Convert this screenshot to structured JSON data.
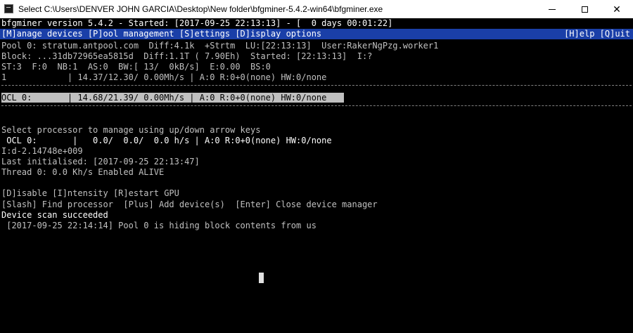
{
  "window": {
    "title": "Select C:\\Users\\DENVER JOHN GARCIA\\Desktop\\New folder\\bfgminer-5.4.2-win64\\bfgminer.exe",
    "min_glyph": "minimize-icon",
    "max_glyph": "maximize-icon",
    "close_glyph": "✕"
  },
  "console": {
    "header": "bfgminer version 5.4.2 - Started: [2017-09-25 22:13:13] - [  0 days 00:01:22]",
    "menu_left": "[M]anage devices [P]ool management [S]ettings [D]isplay options",
    "menu_right": "[H]elp [Q]uit",
    "pool_line": "Pool 0: stratum.antpool.com  Diff:4.1k  +Strtm  LU:[22:13:13]  User:RakerNgPzg.worker1",
    "block_line": "Block: ...31db72965ea5815d  Diff:1.1T ( 7.90Eh)  Started: [22:13:13]  I:?",
    "stats_line": "ST:3  F:0  NB:1  AS:0  BW:[ 13/  0kB/s]  E:0.00  BS:0",
    "summary_line": "1            | 14.37/12.30/ 0.00Mh/s | A:0 R:0+0(none) HW:0/none",
    "device_row": "OCL 0:       | 14.68/21.39/ 0.00Mh/s | A:0 R:0+0(none) HW:0/none",
    "select_prompt": "Select processor to manage using up/down arrow keys",
    "proc_line": " OCL 0:       |   0.0/  0.0/  0.0 h/s | A:0 R:0+0(none) HW:0/none",
    "intensity_line": "I:d-2.14748e+009",
    "last_init_line": "Last initialised: [2017-09-25 22:13:47]",
    "thread_line": "Thread 0: 0.0 Kh/s Enabled ALIVE",
    "gpu_options": "[D]isable [I]ntensity [R]estart GPU",
    "manager_options": "[Slash] Find processor  [Plus] Add device(s)  [Enter] Close device manager",
    "scan_status": "Device scan succeeded",
    "log_line": " [2017-09-25 22:14:14] Pool 0 is hiding block contents from us"
  },
  "colors": {
    "menu_bar": "#1a3fa8",
    "terminal_bg": "#000000",
    "terminal_fg": "#c0c0c0",
    "highlight_bg": "#c0c0c0"
  }
}
